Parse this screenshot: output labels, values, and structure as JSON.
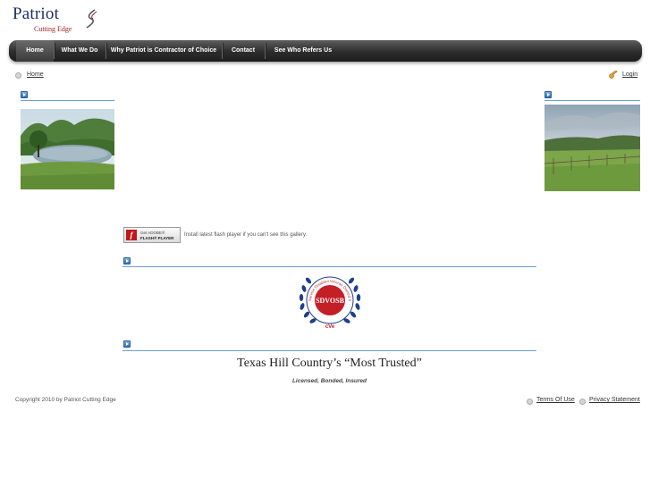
{
  "logo": {
    "name": "Patriot",
    "tagline": "Cutting Edge"
  },
  "nav": {
    "items": [
      "Home",
      "What We Do",
      "Why Patriot is Contractor of Choice",
      "Contact",
      "See Who Refers Us"
    ]
  },
  "breadcrumb": {
    "home": "Home"
  },
  "login": {
    "label": "Login"
  },
  "flash": {
    "badge_line1": "Get ADOBE®",
    "badge_line2": "FLASH® PLAYER",
    "message": "Install latest flash player if you can't see this gallery."
  },
  "seal": {
    "center": "SDVOSB",
    "ring": "Service Disabled Veteran Owned Small Business",
    "bottom": "cVe"
  },
  "headline": "Texas Hill Country’s “Most Trusted”",
  "subline": "Licensed, Bonded, Insured",
  "footer": {
    "copyright": "Copyright 2010 by Patriot Cutting Edge",
    "terms": "Terms Of Use",
    "privacy": "Privacy Statement"
  }
}
